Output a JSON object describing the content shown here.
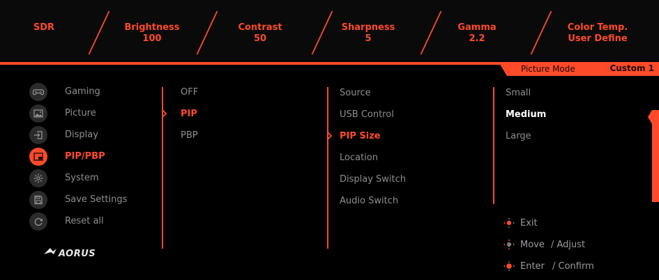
{
  "top_status": {
    "mode": "SDR",
    "items": [
      {
        "label": "Brightness",
        "value": "100"
      },
      {
        "label": "Contrast",
        "value": "50"
      },
      {
        "label": "Sharpness",
        "value": "5"
      },
      {
        "label": "Gamma",
        "value": "2.2"
      },
      {
        "label": "Color Temp.",
        "value": "User Define"
      }
    ]
  },
  "header": {
    "picture_mode_label": "Picture Mode",
    "picture_mode_value": "Custom 1"
  },
  "nav": {
    "items": [
      {
        "label": "Gaming",
        "icon": "gamepad-icon",
        "active": false
      },
      {
        "label": "Picture",
        "icon": "picture-icon",
        "active": false
      },
      {
        "label": "Display",
        "icon": "display-input-icon",
        "active": false
      },
      {
        "label": "PIP/PBP",
        "icon": "pip-icon",
        "active": true
      },
      {
        "label": "System",
        "icon": "gear-icon",
        "active": false
      },
      {
        "label": "Save Settings",
        "icon": "save-icon",
        "active": false
      },
      {
        "label": "Reset all",
        "icon": "reset-icon",
        "active": false
      }
    ]
  },
  "column1": {
    "options": [
      "OFF",
      "PIP",
      "PBP"
    ],
    "selected": "PIP"
  },
  "column2": {
    "options": [
      "Source",
      "USB Control",
      "PIP Size",
      "Location",
      "Display Switch",
      "Audio Switch"
    ],
    "selected": "PIP Size"
  },
  "column3": {
    "options": [
      "Small",
      "Medium",
      "Large"
    ],
    "selected": "Medium"
  },
  "hints": {
    "exit": "Exit",
    "move": "Move",
    "adjust": "/ Adjust",
    "enter": "Enter",
    "confirm": "/ Confirm"
  },
  "colors": {
    "accent": "#ff4a2a",
    "background": "#000000",
    "text": "#8e8e8e",
    "selected_value": "#ffffff"
  }
}
